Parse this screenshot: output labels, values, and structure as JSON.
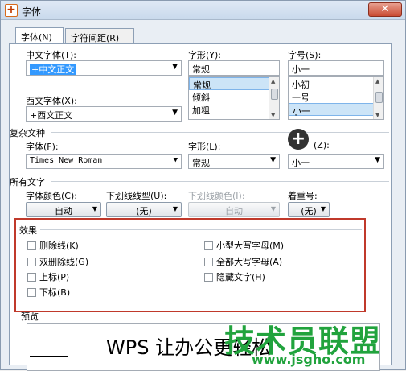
{
  "window": {
    "title": "字体",
    "close_glyph": "✕",
    "app_icon_glyph": "+"
  },
  "tabs": [
    {
      "label": "字体(N)"
    },
    {
      "label": "字符间距(R)"
    }
  ],
  "chinese_font": {
    "label": "中文字体(T):",
    "value": "+中文正文"
  },
  "style": {
    "label": "字形(Y):",
    "value": "常规",
    "options": [
      "常规",
      "倾斜",
      "加粗"
    ]
  },
  "size": {
    "label": "字号(S):",
    "value": "小一",
    "options": [
      "小初",
      "一号",
      "小一"
    ]
  },
  "western_font": {
    "label": "西文字体(X):",
    "value": "+西文正文"
  },
  "complex": {
    "section": "复杂文种",
    "font_label": "字体(F):",
    "font_value": "Times New Roman",
    "style_label": "字形(L):",
    "style_value": "常规",
    "size_label": "(Z):",
    "size_value": "小一"
  },
  "all_text": {
    "section": "所有文字",
    "color_label": "字体颜色(C):",
    "color_value": "自动",
    "underline_label": "下划线线型(U):",
    "underline_value": "(无)",
    "underline_color_label": "下划线颜色(I):",
    "underline_color_value": "自动",
    "emphasis_label": "着重号:",
    "emphasis_value": "(无)"
  },
  "effects": {
    "section": "效果",
    "left": [
      "删除线(K)",
      "双删除线(G)",
      "上标(P)",
      "下标(B)"
    ],
    "right": [
      "小型大写字母(M)",
      "全部大写字母(A)",
      "隐藏文字(H)"
    ]
  },
  "preview": {
    "section": "预览",
    "text": "WPS 让办公更轻松"
  },
  "watermark": {
    "text": "技术员联盟",
    "url": "www.jsgho.com"
  },
  "colors": {
    "highlight": "#3399ff",
    "effects_border": "#c0392b",
    "watermark": "#21a33d"
  }
}
